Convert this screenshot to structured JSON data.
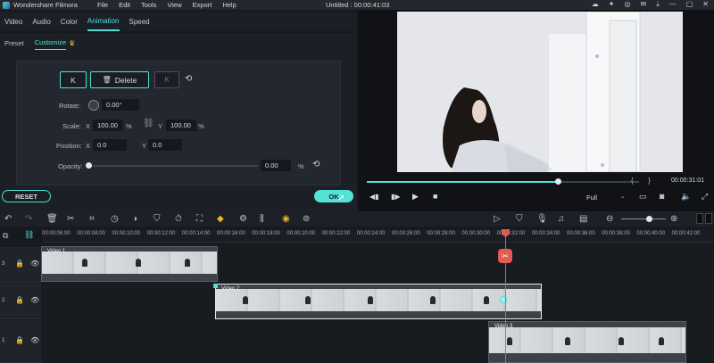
{
  "titlebar": {
    "app_name": "Wondershare Filmora",
    "menu": [
      "File",
      "Edit",
      "Tools",
      "View",
      "Export",
      "Help"
    ],
    "doc_title": "Untitled : 00:00:41:03"
  },
  "tabs": [
    "Video",
    "Audio",
    "Color",
    "Animation",
    "Speed"
  ],
  "active_tab": "Animation",
  "subtabs": [
    "Preset",
    "Customize"
  ],
  "active_subtab": "Customize",
  "keyframe": {
    "prev_label": "K",
    "delete_label": "Delete",
    "next_label": "K"
  },
  "transform": {
    "rotate_label": "Rotate:",
    "rotate_value": "0.00°",
    "scale_label": "Scale:",
    "scale_x_label": "X",
    "scale_x_value": "100.00",
    "scale_x_unit": "%",
    "scale_y_label": "Y",
    "scale_y_value": "100.00",
    "scale_y_unit": "%",
    "position_label": "Position:",
    "pos_x_label": "X",
    "pos_x_value": "0.0",
    "pos_y_label": "Y",
    "pos_y_value": "0.0",
    "opacity_label": "Opacity:",
    "opacity_value": "0.00",
    "opacity_unit": "%"
  },
  "buttons": {
    "reset": "RESET",
    "ok": "OK"
  },
  "playback": {
    "timecode": "00:00:31:01",
    "progress": 0.7,
    "quality": "Full",
    "brackets_open": "{",
    "brackets_close": "}"
  },
  "ruler_labels": [
    "00:00:06:00",
    "00:00:08:00",
    "00:00:10:00",
    "00:00:12:00",
    "00:00:14:00",
    "00:00:16:00",
    "00:00:18:00",
    "00:00:20:00",
    "00:00:22:00",
    "00:00:24:00",
    "00:00:26:00",
    "00:00:28:00",
    "00:00:30:00",
    "00:00:32:00",
    "00:00:34:00",
    "00:00:36:00",
    "00:00:38:00",
    "00:00:40:00",
    "00:00:42:00"
  ],
  "clips": [
    {
      "label": "Video 1"
    },
    {
      "label": "Video 2"
    },
    {
      "label": "Video 3"
    }
  ],
  "track_numbers": [
    "3",
    "2",
    "1"
  ],
  "colors": {
    "accent": "#4ee0d3",
    "playhead": "#e35b4f"
  }
}
